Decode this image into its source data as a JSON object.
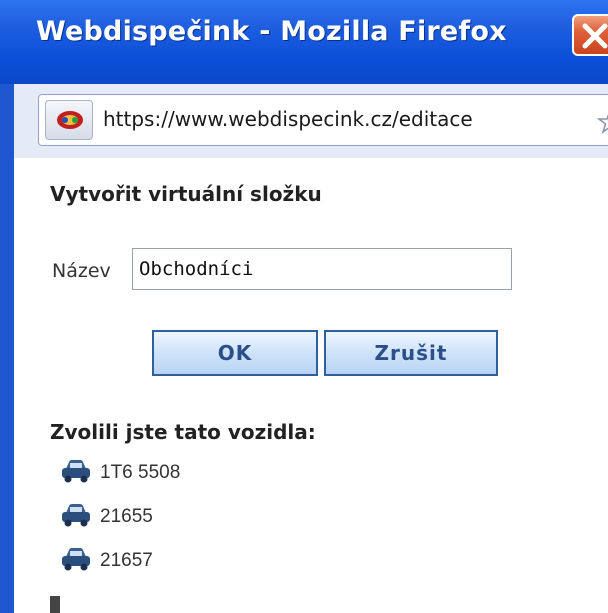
{
  "window": {
    "title": "Webdispečink - Mozilla Firefox"
  },
  "urlbar": {
    "url": "https://www.webdispecink.cz/editace"
  },
  "dialog": {
    "heading": "Vytvořit virtuální složku",
    "name_label": "Název",
    "name_value": "Obchodníci",
    "ok_label": "OK",
    "cancel_label": "Zrušit",
    "selected_title": "Zvolili jste tato vozidla:",
    "vehicles": [
      {
        "plate": "1T6 5508"
      },
      {
        "plate": "21655"
      },
      {
        "plate": "21657"
      }
    ]
  },
  "colors": {
    "titlebar": "#0b4fd8",
    "button_border": "#2f5f9c",
    "button_fill": "#cfe3fa"
  },
  "icons": {
    "close": "close-icon",
    "site": "site-identity-icon",
    "bookmark": "star-icon",
    "vehicle": "car-icon"
  }
}
